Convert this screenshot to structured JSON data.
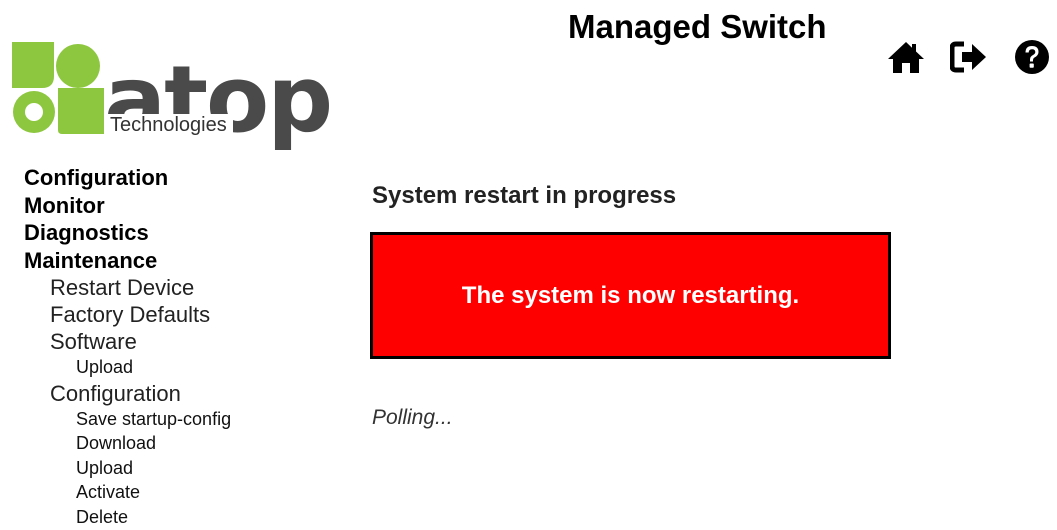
{
  "header": {
    "app_title": "Managed Switch",
    "icons": {
      "home": "home-icon",
      "logout": "logout-icon",
      "help": "help-icon"
    }
  },
  "logo": {
    "brand": "atop",
    "subtitle": "Technologies",
    "color_green": "#8dc63f",
    "color_gray": "#4a4a4a"
  },
  "sidebar": {
    "configuration": "Configuration",
    "monitor": "Monitor",
    "diagnostics": "Diagnostics",
    "maintenance": {
      "label": "Maintenance",
      "restart_device": "Restart Device",
      "factory_defaults": "Factory Defaults",
      "software": {
        "label": "Software",
        "upload": "Upload"
      },
      "configuration": {
        "label": "Configuration",
        "save_startup_config": "Save startup-config",
        "download": "Download",
        "upload": "Upload",
        "activate": "Activate",
        "delete": "Delete"
      }
    }
  },
  "main": {
    "title": "System restart in progress",
    "alert_message": "The system is now restarting.",
    "alert_color": "#ff0000",
    "polling_text": "Polling..."
  }
}
